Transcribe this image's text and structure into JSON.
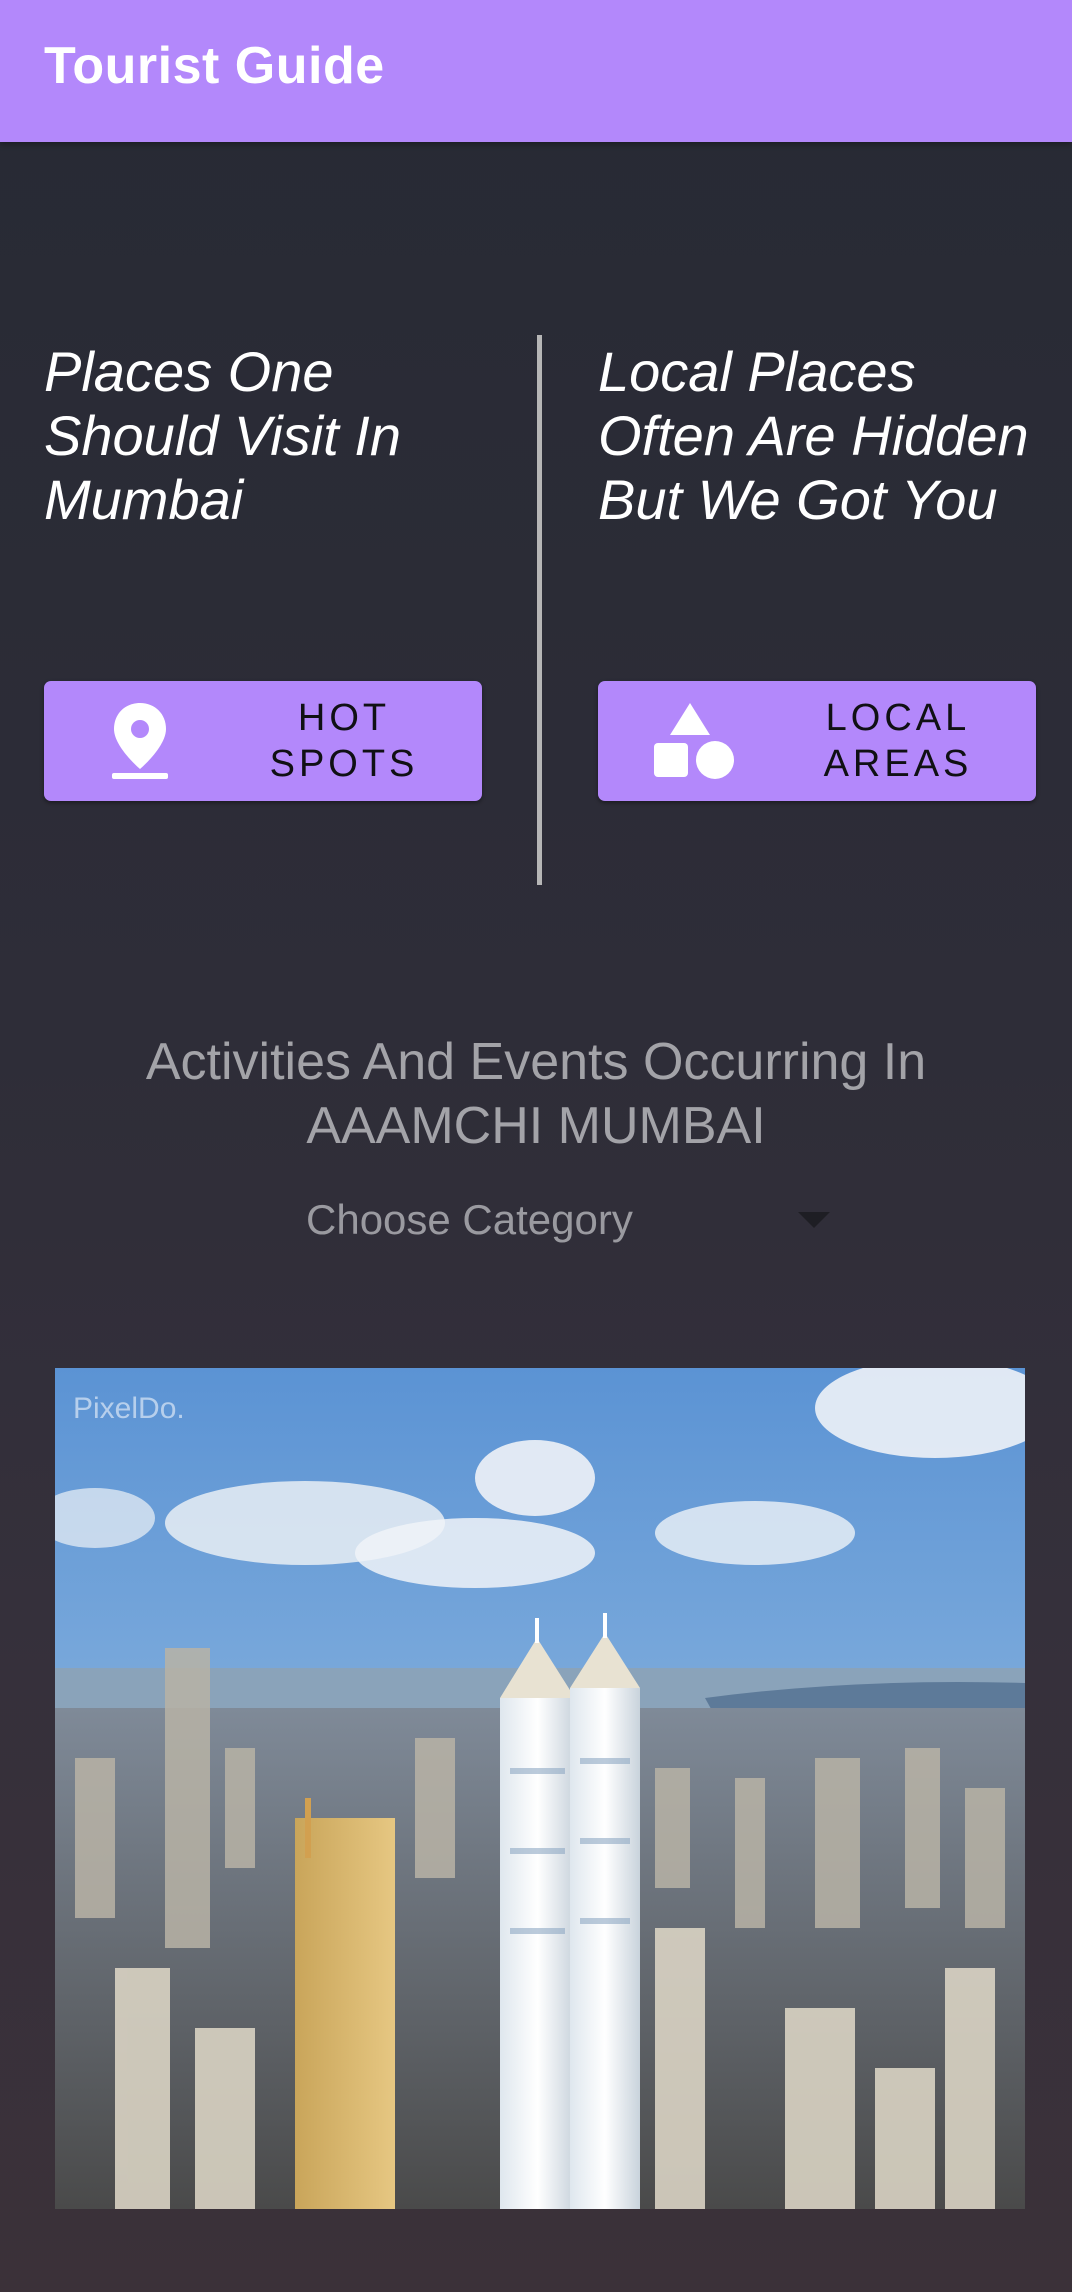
{
  "app": {
    "title": "Tourist Guide"
  },
  "sections": {
    "left_heading": "Places One Should Visit In Mumbai",
    "right_heading": "Local Places Often Are Hidden But We Got You"
  },
  "buttons": {
    "hot_spots": {
      "line1": "HOT",
      "line2": "SPOTS",
      "icon": "location-pin-icon"
    },
    "local_areas": {
      "line1": "LOCAL",
      "line2": "AREAS",
      "icon": "shapes-icon"
    }
  },
  "events": {
    "title_line1": "Activities And Events Occurring In",
    "title_line2": "AAAMCHI MUMBAI",
    "dropdown": {
      "selected": "Choose Category"
    }
  },
  "media": {
    "watermark": "PixelDo."
  },
  "colors": {
    "accent": "#b388fb",
    "background": "#2a2a33",
    "heading_gray": "#a3a3a8"
  }
}
